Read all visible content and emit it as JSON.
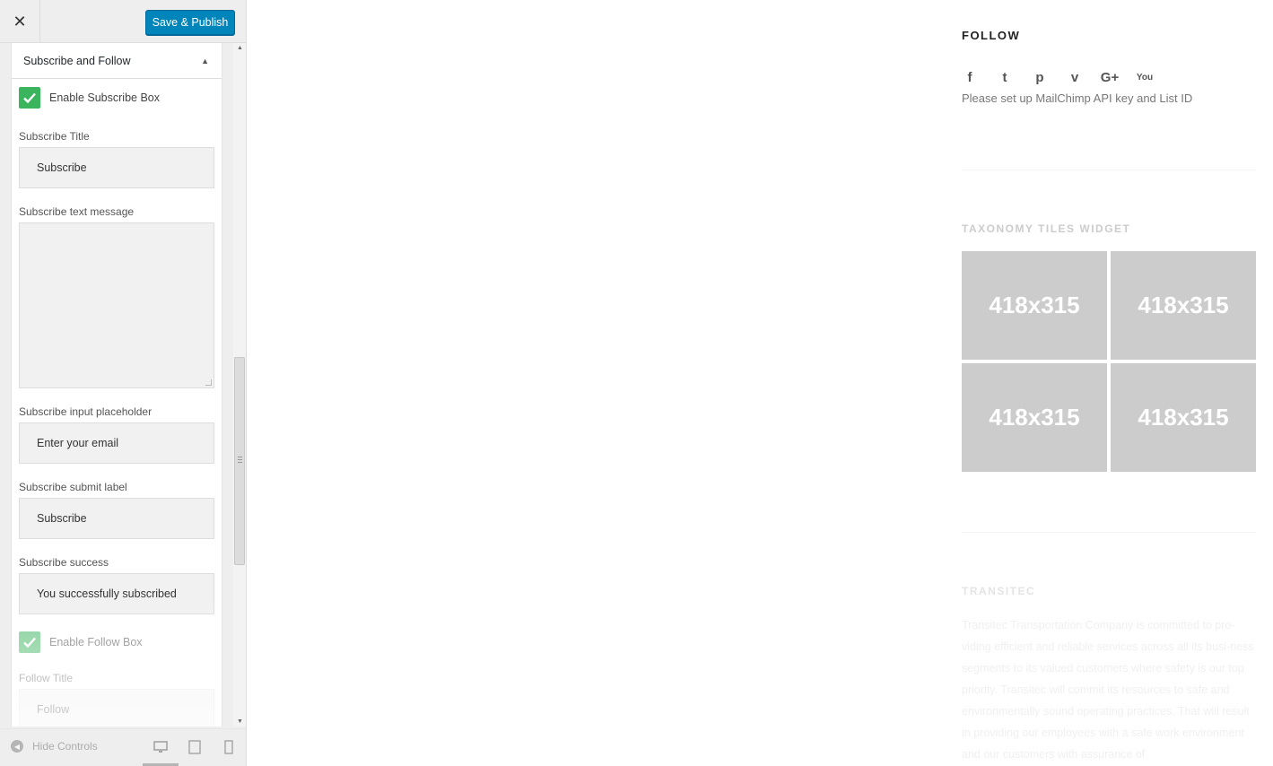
{
  "topbar": {
    "close_label": "✕",
    "publish_label": "Save & Publish",
    "accent_color": "#0085ba"
  },
  "section": {
    "title": "Subscribe and Follow",
    "caret_icon": "caret-up-icon"
  },
  "fields": {
    "enable_subscribe_label": "Enable Subscribe Box",
    "enable_subscribe_checked": true,
    "subscribe_title_label": "Subscribe Title",
    "subscribe_title_value": "Subscribe",
    "subscribe_text_label": "Subscribe text message",
    "subscribe_text_value": "",
    "subscribe_placeholder_label": "Subscribe input placeholder",
    "subscribe_placeholder_value": "Enter your email",
    "subscribe_submit_label": "Subscribe submit label",
    "subscribe_submit_value": "Subscribe",
    "subscribe_success_label": "Subscribe success",
    "subscribe_success_value": "You successfully subscribed",
    "enable_follow_label": "Enable Follow Box",
    "enable_follow_checked": true,
    "follow_title_label": "Follow Title",
    "follow_title_value": "Follow",
    "checkbox_color": "#3bb55d"
  },
  "footer": {
    "hide_controls_label": "Hide Controls",
    "devices": [
      "desktop-icon",
      "tablet-icon",
      "mobile-icon"
    ]
  },
  "preview": {
    "follow_title": "FOLLOW",
    "social_icons": [
      "facebook-icon",
      "twitter-icon",
      "pinterest-icon",
      "vimeo-icon",
      "google-plus-icon",
      "youtube-icon"
    ],
    "social_glyphs": [
      "f",
      "t",
      "p",
      "v",
      "G+",
      "You"
    ],
    "mailchimp_note": "Please set up MailChimp API key and List ID",
    "taxonomy_title": "TAXONOMY TILES WIDGET",
    "tiles": [
      "418x315",
      "418x315",
      "418x315",
      "418x315"
    ],
    "transitec_title": "TRANSITEC",
    "transitec_text": "Transitec Transportation Company is committed to pro-viding efficient and reliable services across all its busi-ness segments to its valued customers where safety is our top priority. Transitec will commit its resources to safe and environmentally sound operating practices. That will result in providing our employees with a safe work environment and our customers with assurance of"
  }
}
